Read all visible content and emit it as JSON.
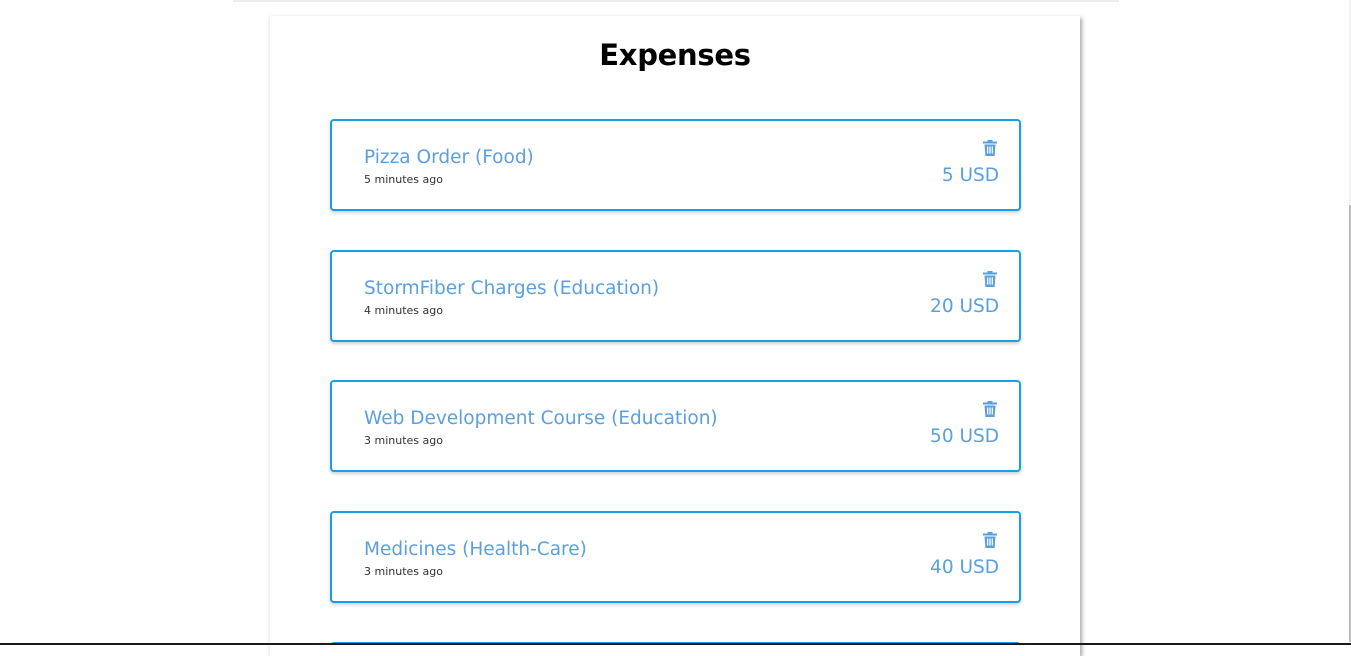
{
  "page": {
    "title": "Expenses"
  },
  "colors": {
    "accent_border": "#1a9ee8",
    "text_blue": "#5b9fdf"
  },
  "expenses": [
    {
      "title": "Pizza Order (Food)",
      "time": "5 minutes ago",
      "amount": "5 USD",
      "delete_icon": "trash-icon"
    },
    {
      "title": "StormFiber Charges (Education)",
      "time": "4 minutes ago",
      "amount": "20 USD",
      "delete_icon": "trash-icon"
    },
    {
      "title": "Web Development Course (Education)",
      "time": "3 minutes ago",
      "amount": "50 USD",
      "delete_icon": "trash-icon"
    },
    {
      "title": "Medicines (Health-Care)",
      "time": "3 minutes ago",
      "amount": "40 USD",
      "delete_icon": "trash-icon"
    }
  ]
}
